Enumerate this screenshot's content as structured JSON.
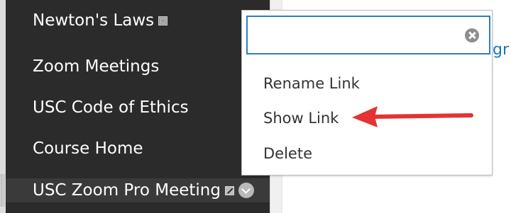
{
  "sidebar": {
    "items": [
      {
        "label": "Newton's Laws",
        "badge": "dotted-square-icon"
      },
      {
        "label": "Zoom Meetings"
      },
      {
        "label": "USC Code of Ethics"
      },
      {
        "label": "Course Home"
      },
      {
        "label": "USC Zoom Pro Meeting",
        "badge": "hidden-link-icon",
        "menu": "chevron-down-icon"
      }
    ]
  },
  "content": {
    "peek_text": "gr"
  },
  "context_menu": {
    "rename_input": {
      "value": "",
      "placeholder": ""
    },
    "options": [
      {
        "label": "Rename Link"
      },
      {
        "label": "Show Link"
      },
      {
        "label": "Delete"
      }
    ]
  },
  "colors": {
    "sidebar_bg": "#2b2b2b",
    "focus_border": "#2f7ec2",
    "link_blue": "#1d75b3",
    "annotation_red": "#e53232"
  }
}
